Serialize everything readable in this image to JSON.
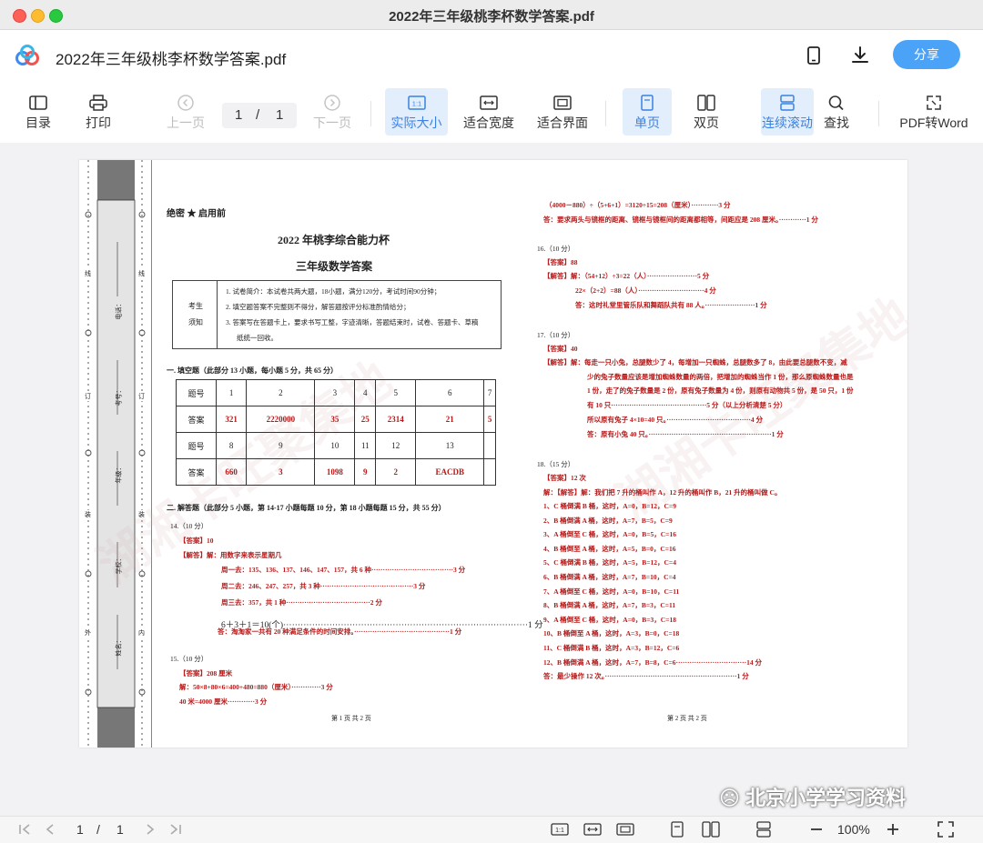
{
  "window": {
    "title": "2022年三年级桃李杯数学答案.pdf"
  },
  "header": {
    "doc_name": "2022年三年级桃李杯数学答案.pdf",
    "share_label": "分享"
  },
  "toolbar": {
    "toc": "目录",
    "print": "打印",
    "prev_page": "上一页",
    "page_current": "1",
    "page_sep": "/",
    "page_total": "1",
    "next_page": "下一页",
    "actual_size": "实际大小",
    "fit_width": "适合宽度",
    "fit_window": "适合界面",
    "single_page": "单页",
    "double_page": "双页",
    "continuous": "连续滚动",
    "find": "查找",
    "pdf_to_word": "PDF转Word"
  },
  "document": {
    "secret": "绝密 ★ 启用前",
    "title1": "2022 年桃李综合能力杯",
    "title2": "三年级数学答案",
    "notice_label1": "考生",
    "notice_label2": "须知",
    "notice_items": [
      "1. 试卷简介：本试卷共两大题，18小题，满分120分，考试时间90分钟；",
      "2. 填空题答案不完整则不得分，解答题按评分标准酌情给分；",
      "3. 答案写在答题卡上，要求书写工整，字迹清晰，答题结束时，试卷、答题卡、草稿",
      "纸统一回收。"
    ],
    "section1": "一. 填空题（此部分 13 小题，每小题 5 分，共 65 分）",
    "table_q_label": "题号",
    "table_a_label": "答案",
    "table_row1_q": [
      "1",
      "2",
      "3",
      "4",
      "5",
      "6",
      "7"
    ],
    "table_row1_a": [
      "321",
      "2220000",
      "35",
      "25",
      "2314",
      "21",
      "5"
    ],
    "table_row2_q": [
      "8",
      "9",
      "10",
      "11",
      "12",
      "13",
      ""
    ],
    "table_row2_a": [
      "660",
      "3",
      "1098",
      "9",
      "2",
      "EACDB",
      ""
    ],
    "section2": "二. 解答题（此部分 5 小题，第 14-17 小题每题 10 分，第 18 小题每题 15 分，共 55 分）",
    "left_lines": [
      {
        "t": "14.（10 分）",
        "red": false
      },
      {
        "t": "【答案】10",
        "red": true
      },
      {
        "t": "【解答】解：用数字来表示星期几",
        "red": true
      },
      {
        "t": "周一去：135、136、137、146、147、157，共 6 种····································3 分",
        "red": true
      },
      {
        "t": "周二去：246、247、257，共 3 种·········································3 分",
        "red": true
      },
      {
        "t": "周三去：357，共 1 种·····································2 分",
        "red": true
      },
      {
        "t": "6＋3＋1＝10(个)·····················································································1 分",
        "red": false
      },
      {
        "t": "答：淘淘家一共有 20 种满足条件的时间安排。··········································1 分",
        "red": true
      },
      {
        "t": "15.（10 分）",
        "red": false
      },
      {
        "t": "【答案】208 厘米",
        "red": true
      },
      {
        "t": "解：50×8+80×6=400+480=880（厘米）·············3 分",
        "red": true
      },
      {
        "t": "40 米=4000 厘米············3 分",
        "red": true
      }
    ],
    "right_lines": [
      {
        "t": "（4000－880）÷（5+6+1）=3120÷15=208（厘米）············3 分",
        "red": true
      },
      {
        "t": "答：要求两头与镜框的距离、镜框与镜框间的距离都相等，间距应是 208 厘米。············1 分",
        "red": true
      },
      {
        "t": "16.（10 分）",
        "red": false
      },
      {
        "t": "【答案】88",
        "red": true
      },
      {
        "t": "【解答】解：（54+12）÷3=22（人）······················5 分",
        "red": true
      },
      {
        "t": "22×（2+2）=88（人）·····························4 分",
        "red": true
      },
      {
        "t": "答：这时礼堂里管乐队和舞蹈队共有 88 人。······················1 分",
        "red": true
      },
      {
        "t": "17.（10 分）",
        "red": false
      },
      {
        "t": "【答案】40",
        "red": true
      },
      {
        "t": "【解答】解：每走一只小兔，总腿数少了 4，每增加一只蜘蛛，总腿数多了 8，由此要总腿数不变，减",
        "red": true
      },
      {
        "t": "少的兔子数量应该是增加蜘蛛数量的两倍，把增加的蜘蛛当作 1 份，那么原蜘蛛数量也是",
        "red": true
      },
      {
        "t": "1 份，走了的兔子数量是 2 份，原有兔子数量为 4 份，则原有动物共 5 份，是 50 只，1 份",
        "red": true
      },
      {
        "t": "有 10 只··········································5 分（以上分析清楚 5 分）",
        "red": true
      },
      {
        "t": "所以原有兔子 4×10=40 只。·····································4 分",
        "red": true
      },
      {
        "t": "答：原有小兔 40 只。······················································1 分",
        "red": true
      },
      {
        "t": "18.（15 分）",
        "red": false
      },
      {
        "t": "【答案】12 次",
        "red": true
      },
      {
        "t": "解：【解答】解：我们把 7 升的桶叫作 A，12 升的桶叫作 B，21 升的桶叫做 C。",
        "red": true
      },
      {
        "t": "1、C 桶倒满 B 桶，这时，A=0，B=12，C=9",
        "red": true
      },
      {
        "t": "2、B 桶倒满 A 桶，这时，A=7，B=5，C=9",
        "red": true
      },
      {
        "t": "3、A 桶倒至 C 桶，这时，A=0，B=5，C=16",
        "red": true
      },
      {
        "t": "4、B 桶倒至 A 桶，这时，A=5，B=0，C=16",
        "red": true
      },
      {
        "t": "5、C 桶倒满 B 桶，这时，A=5，B=12，C=4",
        "red": true
      },
      {
        "t": "6、B 桶倒满 A 桶，这时，A=7，B=10，C=4",
        "red": true
      },
      {
        "t": "7、A 桶倒至 C 桶，这时，A=0，B=10，C=11",
        "red": true
      },
      {
        "t": "8、B 桶倒满 A 桶，这时，A=7，B=3，C=11",
        "red": true
      },
      {
        "t": "9、A 桶倒至 C 桶，这时，A=0，B=3，C=18",
        "red": true
      },
      {
        "t": "10、B 桶倒至 A 桶，这时，A=3，B=0，C=18",
        "red": true
      },
      {
        "t": "11、C 桶倒满 B 桶，这时，A=3，B=12，C=6",
        "red": true
      },
      {
        "t": "12、B 桶倒满 A 桶，这时，A=7，B=8，C=6·······························14 分",
        "red": true
      },
      {
        "t": "答：最少操作 12 次。··························································1 分",
        "red": true
      }
    ],
    "footer_left": "第 1 页 共 2 页",
    "footer_right": "第 2 页 共 2 页",
    "binding_labels": [
      "姓名：",
      "学校：",
      "年级：",
      "考号：",
      "电话："
    ],
    "binding_outer": [
      "外",
      "装",
      "订",
      "线"
    ],
    "binding_inner": [
      "内",
      "装",
      "订",
      "线"
    ],
    "watermark": "湖湘卡旺聚集地"
  },
  "bottom": {
    "page_current": "1",
    "page_sep": "/",
    "page_total": "1",
    "zoom": "100%"
  },
  "overlay": {
    "wechat_mark": "北京小学学习资料"
  },
  "colors": {
    "accent": "#4aa3f7",
    "answer_red": "#b61a1a",
    "active_bg": "#e3eefc"
  }
}
